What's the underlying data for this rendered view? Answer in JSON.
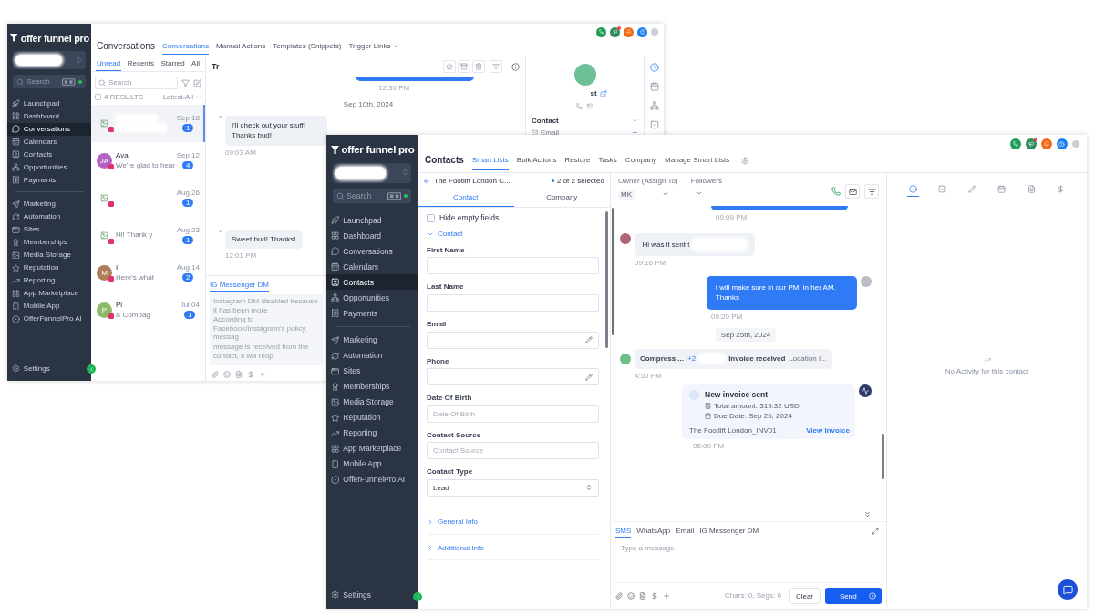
{
  "back_window": {
    "sidebar": {
      "logo": "offer funnel pro",
      "search": {
        "placeholder": "Search"
      },
      "groups": [
        [
          {
            "label": "Launchpad",
            "selected": false
          },
          {
            "label": "Dashboard",
            "selected": false
          },
          {
            "label": "Conversations",
            "selected": true
          },
          {
            "label": "Calendars",
            "selected": false
          },
          {
            "label": "Contacts",
            "selected": false
          },
          {
            "label": "Opportunities",
            "selected": false
          },
          {
            "label": "Payments",
            "selected": false
          }
        ],
        [
          {
            "label": "Marketing",
            "selected": false
          },
          {
            "label": "Automation",
            "selected": false
          },
          {
            "label": "Sites",
            "selected": false
          },
          {
            "label": "Memberships",
            "selected": false
          },
          {
            "label": "Media Storage",
            "selected": false
          },
          {
            "label": "Reputation",
            "selected": false
          },
          {
            "label": "Reporting",
            "selected": false
          },
          {
            "label": "App Marketplace",
            "selected": false
          },
          {
            "label": "Mobile App",
            "selected": false
          },
          {
            "label": "OfferFunnelPro AI",
            "selected": false
          }
        ]
      ],
      "settings": "Settings"
    },
    "header": {
      "title": "Conversations",
      "tabs": [
        {
          "label": "Conversations",
          "selected": true
        },
        {
          "label": "Manual Actions",
          "selected": false
        },
        {
          "label": "Templates (Snippets)",
          "selected": false
        },
        {
          "label": "Trigger Links",
          "selected": false
        }
      ]
    },
    "list": {
      "tabs": [
        {
          "label": "Unread",
          "selected": true
        },
        {
          "label": "Recents",
          "selected": false
        },
        {
          "label": "Starred",
          "selected": false
        },
        {
          "label": "All",
          "selected": false
        }
      ],
      "search": {
        "placeholder": "Search"
      },
      "select_all": {
        "checked": false
      },
      "results": "4 RESULTS",
      "sort": "Latest-All",
      "conversations": [
        {
          "avatar": {
            "kind": "image"
          },
          "redacted": true,
          "date": "Sep 18",
          "unread": "1",
          "selected": true
        },
        {
          "avatar": {
            "kind": "initials",
            "text": "JA",
            "color": "#b461c4"
          },
          "redacted": false,
          "name": "Ava",
          "preview": "We're glad to hear",
          "date": "Sep 12",
          "unread": "4",
          "selected": false
        },
        {
          "avatar": {
            "kind": "image"
          },
          "redacted": false,
          "date": "Aug 26",
          "unread": "1",
          "selected": false
        },
        {
          "avatar": {
            "kind": "image"
          },
          "redacted": false,
          "preview": "Hi! Thank y",
          "date": "Aug 23",
          "unread": "1",
          "selected": false
        },
        {
          "avatar": {
            "kind": "initials",
            "text": "M",
            "color": "#b07d5a"
          },
          "redacted": false,
          "name": "I",
          "preview": "Here's what",
          "date": "Aug 14",
          "unread": "2",
          "selected": false
        },
        {
          "avatar": {
            "kind": "initials",
            "text": "P",
            "color": "#8dbb6b"
          },
          "redacted": false,
          "name": "Pi",
          "preview": "& Compag",
          "date": "Jul 04",
          "unread": "1",
          "selected": false
        }
      ]
    },
    "chat": {
      "title": "Tr",
      "earlier_time": "12:30 PM",
      "date_separator": "Sep 10th, 2024",
      "messages": [
        {
          "text": "I'll check out your stuff!  Thanks bud!",
          "time": "09:03 AM"
        },
        {
          "text": "Sweet bud!  Thanks!",
          "time": "12:01 PM"
        }
      ],
      "compose": {
        "tab": "IG Messenger DM",
        "notice": [
          "Instagram DM disabled because it has been more",
          "According to Facebook/Instagram's policy, messag",
          "message is received from the contact, it will reop"
        ]
      }
    },
    "contact_panel": {
      "name": "st",
      "section": "Contact",
      "field": "Email"
    }
  },
  "front_window": {
    "sidebar": {
      "logo": "offer funnel pro",
      "search": {
        "placeholder": "Search"
      },
      "groups": [
        [
          {
            "label": "Launchpad",
            "selected": false
          },
          {
            "label": "Dashboard",
            "selected": false
          },
          {
            "label": "Conversations",
            "selected": false
          },
          {
            "label": "Calendars",
            "selected": false
          },
          {
            "label": "Contacts",
            "selected": true
          },
          {
            "label": "Opportunities",
            "selected": false
          },
          {
            "label": "Payments",
            "selected": false
          }
        ],
        [
          {
            "label": "Marketing",
            "selected": false
          },
          {
            "label": "Automation",
            "selected": false
          },
          {
            "label": "Sites",
            "selected": false
          },
          {
            "label": "Memberships",
            "selected": false
          },
          {
            "label": "Media Storage",
            "selected": false
          },
          {
            "label": "Reputation",
            "selected": false
          },
          {
            "label": "Reporting",
            "selected": false
          },
          {
            "label": "App Marketplace",
            "selected": false
          },
          {
            "label": "Mobile App",
            "selected": false
          },
          {
            "label": "OfferFunnelPro AI",
            "selected": false
          }
        ]
      ],
      "settings": "Settings"
    },
    "header": {
      "title": "Contacts",
      "tabs": [
        {
          "label": "Smart Lists",
          "selected": true
        },
        {
          "label": "Bulk Actions",
          "selected": false
        },
        {
          "label": "Restore",
          "selected": false
        },
        {
          "label": "Tasks",
          "selected": false
        },
        {
          "label": "Company",
          "selected": false
        },
        {
          "label": "Manage Smart Lists",
          "selected": false
        }
      ]
    },
    "contact": {
      "name": "The Footlift London C...",
      "selection": "2 of 2 selected",
      "tabs": [
        {
          "label": "Contact",
          "selected": true
        },
        {
          "label": "Company",
          "selected": false
        }
      ],
      "hide_empty": {
        "label": "Hide empty fields",
        "checked": false
      },
      "section": {
        "label": "Contact",
        "expanded": true
      },
      "fields": [
        {
          "kind": "text",
          "label": "First Name"
        },
        {
          "kind": "text",
          "label": "Last Name"
        },
        {
          "kind": "editable",
          "label": "Email"
        },
        {
          "kind": "editable",
          "label": "Phone"
        },
        {
          "kind": "text",
          "label": "Date Of Birth",
          "placeholder": "Date Of Birth"
        },
        {
          "kind": "text",
          "label": "Contact Source",
          "placeholder": "Contact Source"
        },
        {
          "kind": "select",
          "label": "Contact Type",
          "value": "Lead"
        }
      ],
      "sections": [
        {
          "label": "General Info",
          "expanded": false
        },
        {
          "label": "Additional Info",
          "expanded": false
        }
      ]
    },
    "chat": {
      "owner": {
        "label": "Owner (Assign To)",
        "value": "MK"
      },
      "followers": {
        "label": "Followers"
      },
      "earlier_time": "09:09 PM",
      "messages": [
        {
          "kind": "incoming",
          "text": "Hi was it sent t",
          "time": "09:16 PM"
        },
        {
          "kind": "outgoing",
          "text": "I will make sure in our PM, in her AM. Thanks",
          "time": "09:20 PM"
        },
        {
          "kind": "date",
          "text": "Sep 25th, 2024"
        },
        {
          "kind": "activity",
          "name": "Compress ...",
          "extra": "+2",
          "event": "Invoice received",
          "location": "Location I...",
          "time": "4:50 PM"
        },
        {
          "kind": "invoice",
          "title": "New invoice sent",
          "amount": "Total amount: 319.32 USD",
          "due": "Due Date: Sep 26, 2024",
          "reference": "The Footlift London_INV01",
          "link": "View Invoice",
          "time": "05:00 PM"
        }
      ],
      "compose": {
        "tabs": [
          {
            "label": "SMS",
            "selected": true
          },
          {
            "label": "WhatsApp",
            "selected": false
          },
          {
            "label": "Email",
            "selected": false
          },
          {
            "label": "IG Messenger DM",
            "selected": false
          }
        ],
        "placeholder": "Type a message",
        "counter": "Chars: 0, Segs: 0",
        "clear": "Clear",
        "send": "Send"
      }
    },
    "activity": {
      "tabs": [
        {
          "selected": true
        },
        {
          "selected": false
        },
        {
          "selected": false
        },
        {
          "selected": false
        },
        {
          "selected": false
        },
        {
          "selected": false
        }
      ],
      "empty": "No Activity for this contact"
    }
  }
}
